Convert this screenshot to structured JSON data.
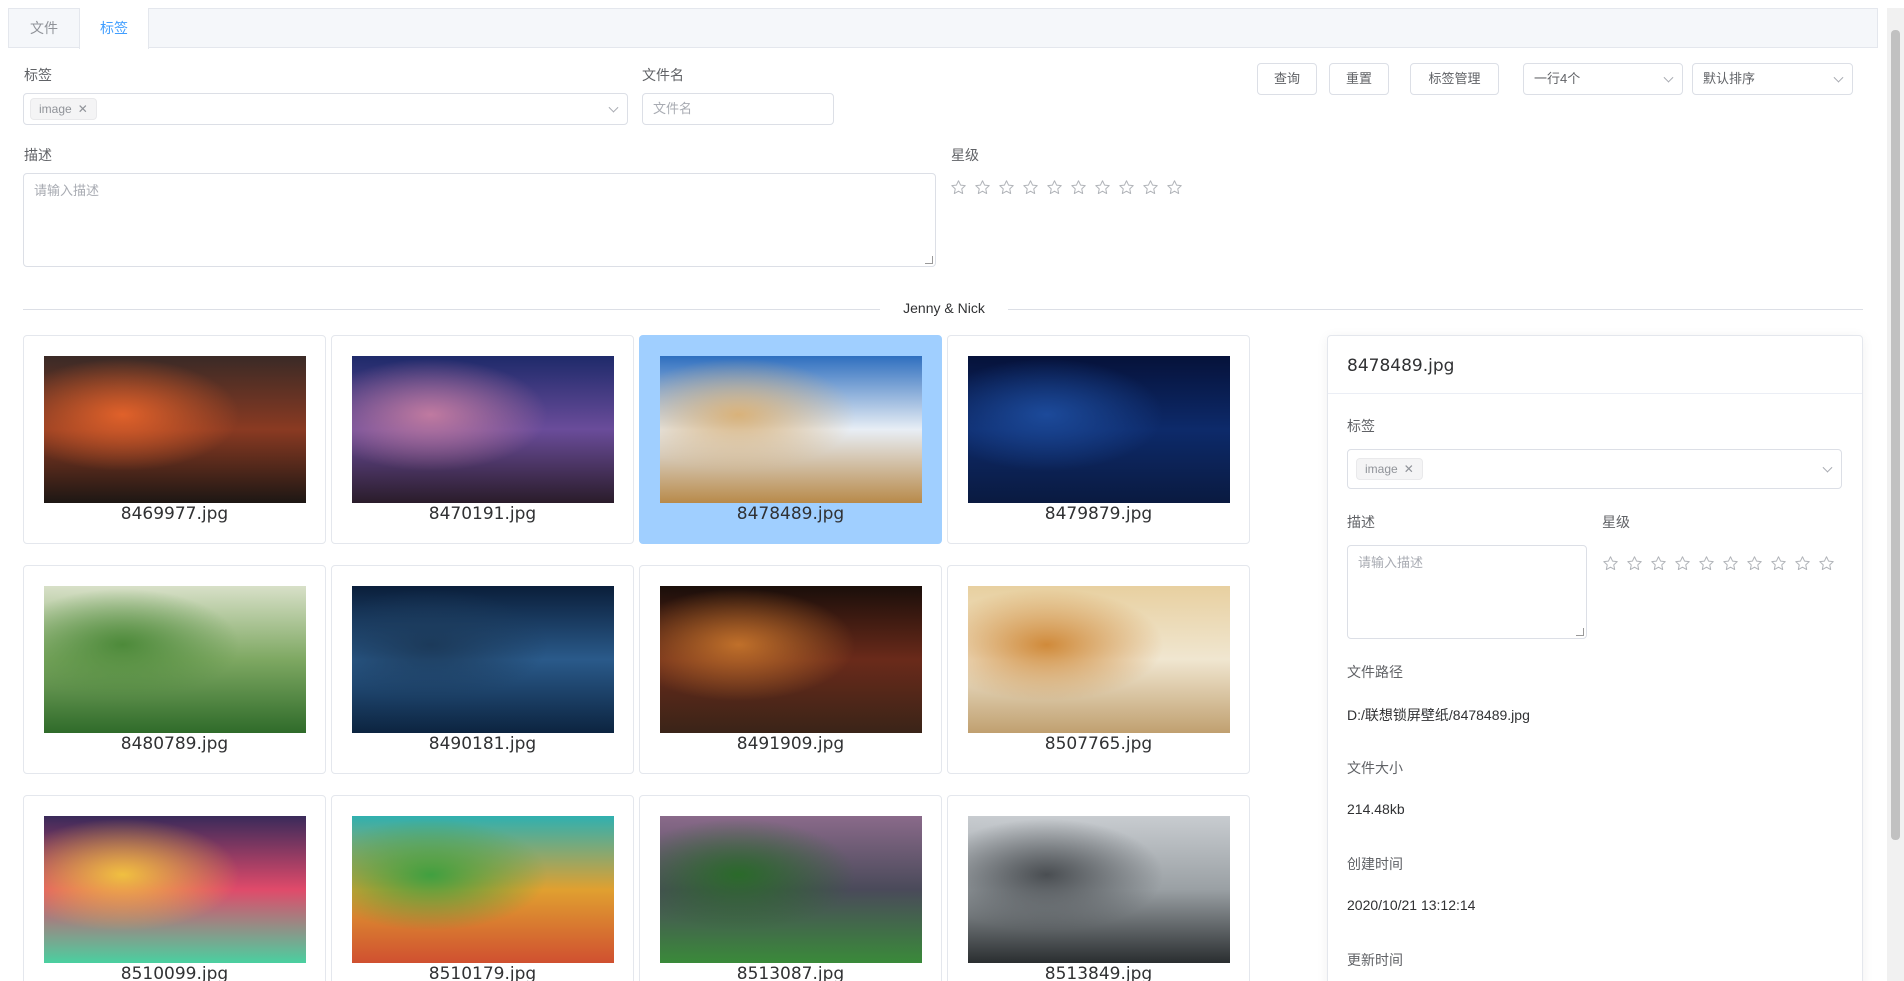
{
  "tabs": [
    {
      "label": "文件"
    },
    {
      "label": "标签",
      "active": true
    }
  ],
  "filters": {
    "tag_label": "标签",
    "tag_value": "image",
    "filename_label": "文件名",
    "filename_placeholder": "文件名",
    "desc_label": "描述",
    "desc_placeholder": "请输入描述",
    "rating_label": "星级",
    "rating_value": 0,
    "rating_max": 10
  },
  "toolbar": {
    "query_label": "查询",
    "reset_label": "重置",
    "tag_manage_label": "标签管理",
    "per_row_value": "一行4个",
    "sort_value": "默认排序"
  },
  "group_title": "Jenny & Nick",
  "images": [
    {
      "name": "8469977.jpg",
      "colors": [
        "#3a2a26",
        "#8a3a22",
        "#e0612a",
        "#1d1714"
      ]
    },
    {
      "name": "8470191.jpg",
      "colors": [
        "#1e2a6a",
        "#6a4c9a",
        "#c07aa0",
        "#2a1c2a"
      ]
    },
    {
      "name": "8478489.jpg",
      "colors": [
        "#2f6fbf",
        "#e8eef5",
        "#d9b27a",
        "#b88a4a"
      ],
      "selected": true
    },
    {
      "name": "8479879.jpg",
      "colors": [
        "#06123a",
        "#0d2a6a",
        "#1c4a9a",
        "#0a1a40"
      ]
    },
    {
      "name": "8480789.jpg",
      "colors": [
        "#d8e0c8",
        "#7ea862",
        "#4d8a3a",
        "#2f6b2a"
      ]
    },
    {
      "name": "8490181.jpg",
      "colors": [
        "#0a1e3a",
        "#2a5a8a",
        "#1c3a5a",
        "#0c2440"
      ]
    },
    {
      "name": "8491909.jpg",
      "colors": [
        "#1a0e0a",
        "#6a2a1a",
        "#c0702a",
        "#3a2418"
      ]
    },
    {
      "name": "8507765.jpg",
      "colors": [
        "#e8d0a0",
        "#f0e6d0",
        "#d08a3a",
        "#c0a070"
      ]
    },
    {
      "name": "8510099.jpg",
      "colors": [
        "#3a2a5a",
        "#e04a6a",
        "#f0c040",
        "#4ad0a0"
      ]
    },
    {
      "name": "8510179.jpg",
      "colors": [
        "#30b0b0",
        "#e0a030",
        "#40a040",
        "#d05030"
      ]
    },
    {
      "name": "8513087.jpg",
      "colors": [
        "#8a6a8a",
        "#4a4a5a",
        "#2a6a2a",
        "#3a8a3a"
      ]
    },
    {
      "name": "8513849.jpg",
      "colors": [
        "#c8ccd0",
        "#9aa0a4",
        "#4a4e52",
        "#2a2e30"
      ]
    }
  ],
  "detail": {
    "title": "8478489.jpg",
    "tag_label": "标签",
    "tag_value": "image",
    "desc_label": "描述",
    "desc_placeholder": "请输入描述",
    "rating_label": "星级",
    "rating_value": 0,
    "path_label": "文件路径",
    "path_value": "D:/联想锁屏壁纸/8478489.jpg",
    "size_label": "文件大小",
    "size_value": "214.48kb",
    "created_label": "创建时间",
    "created_value": "2020/10/21 13:12:14",
    "updated_label": "更新时间"
  }
}
